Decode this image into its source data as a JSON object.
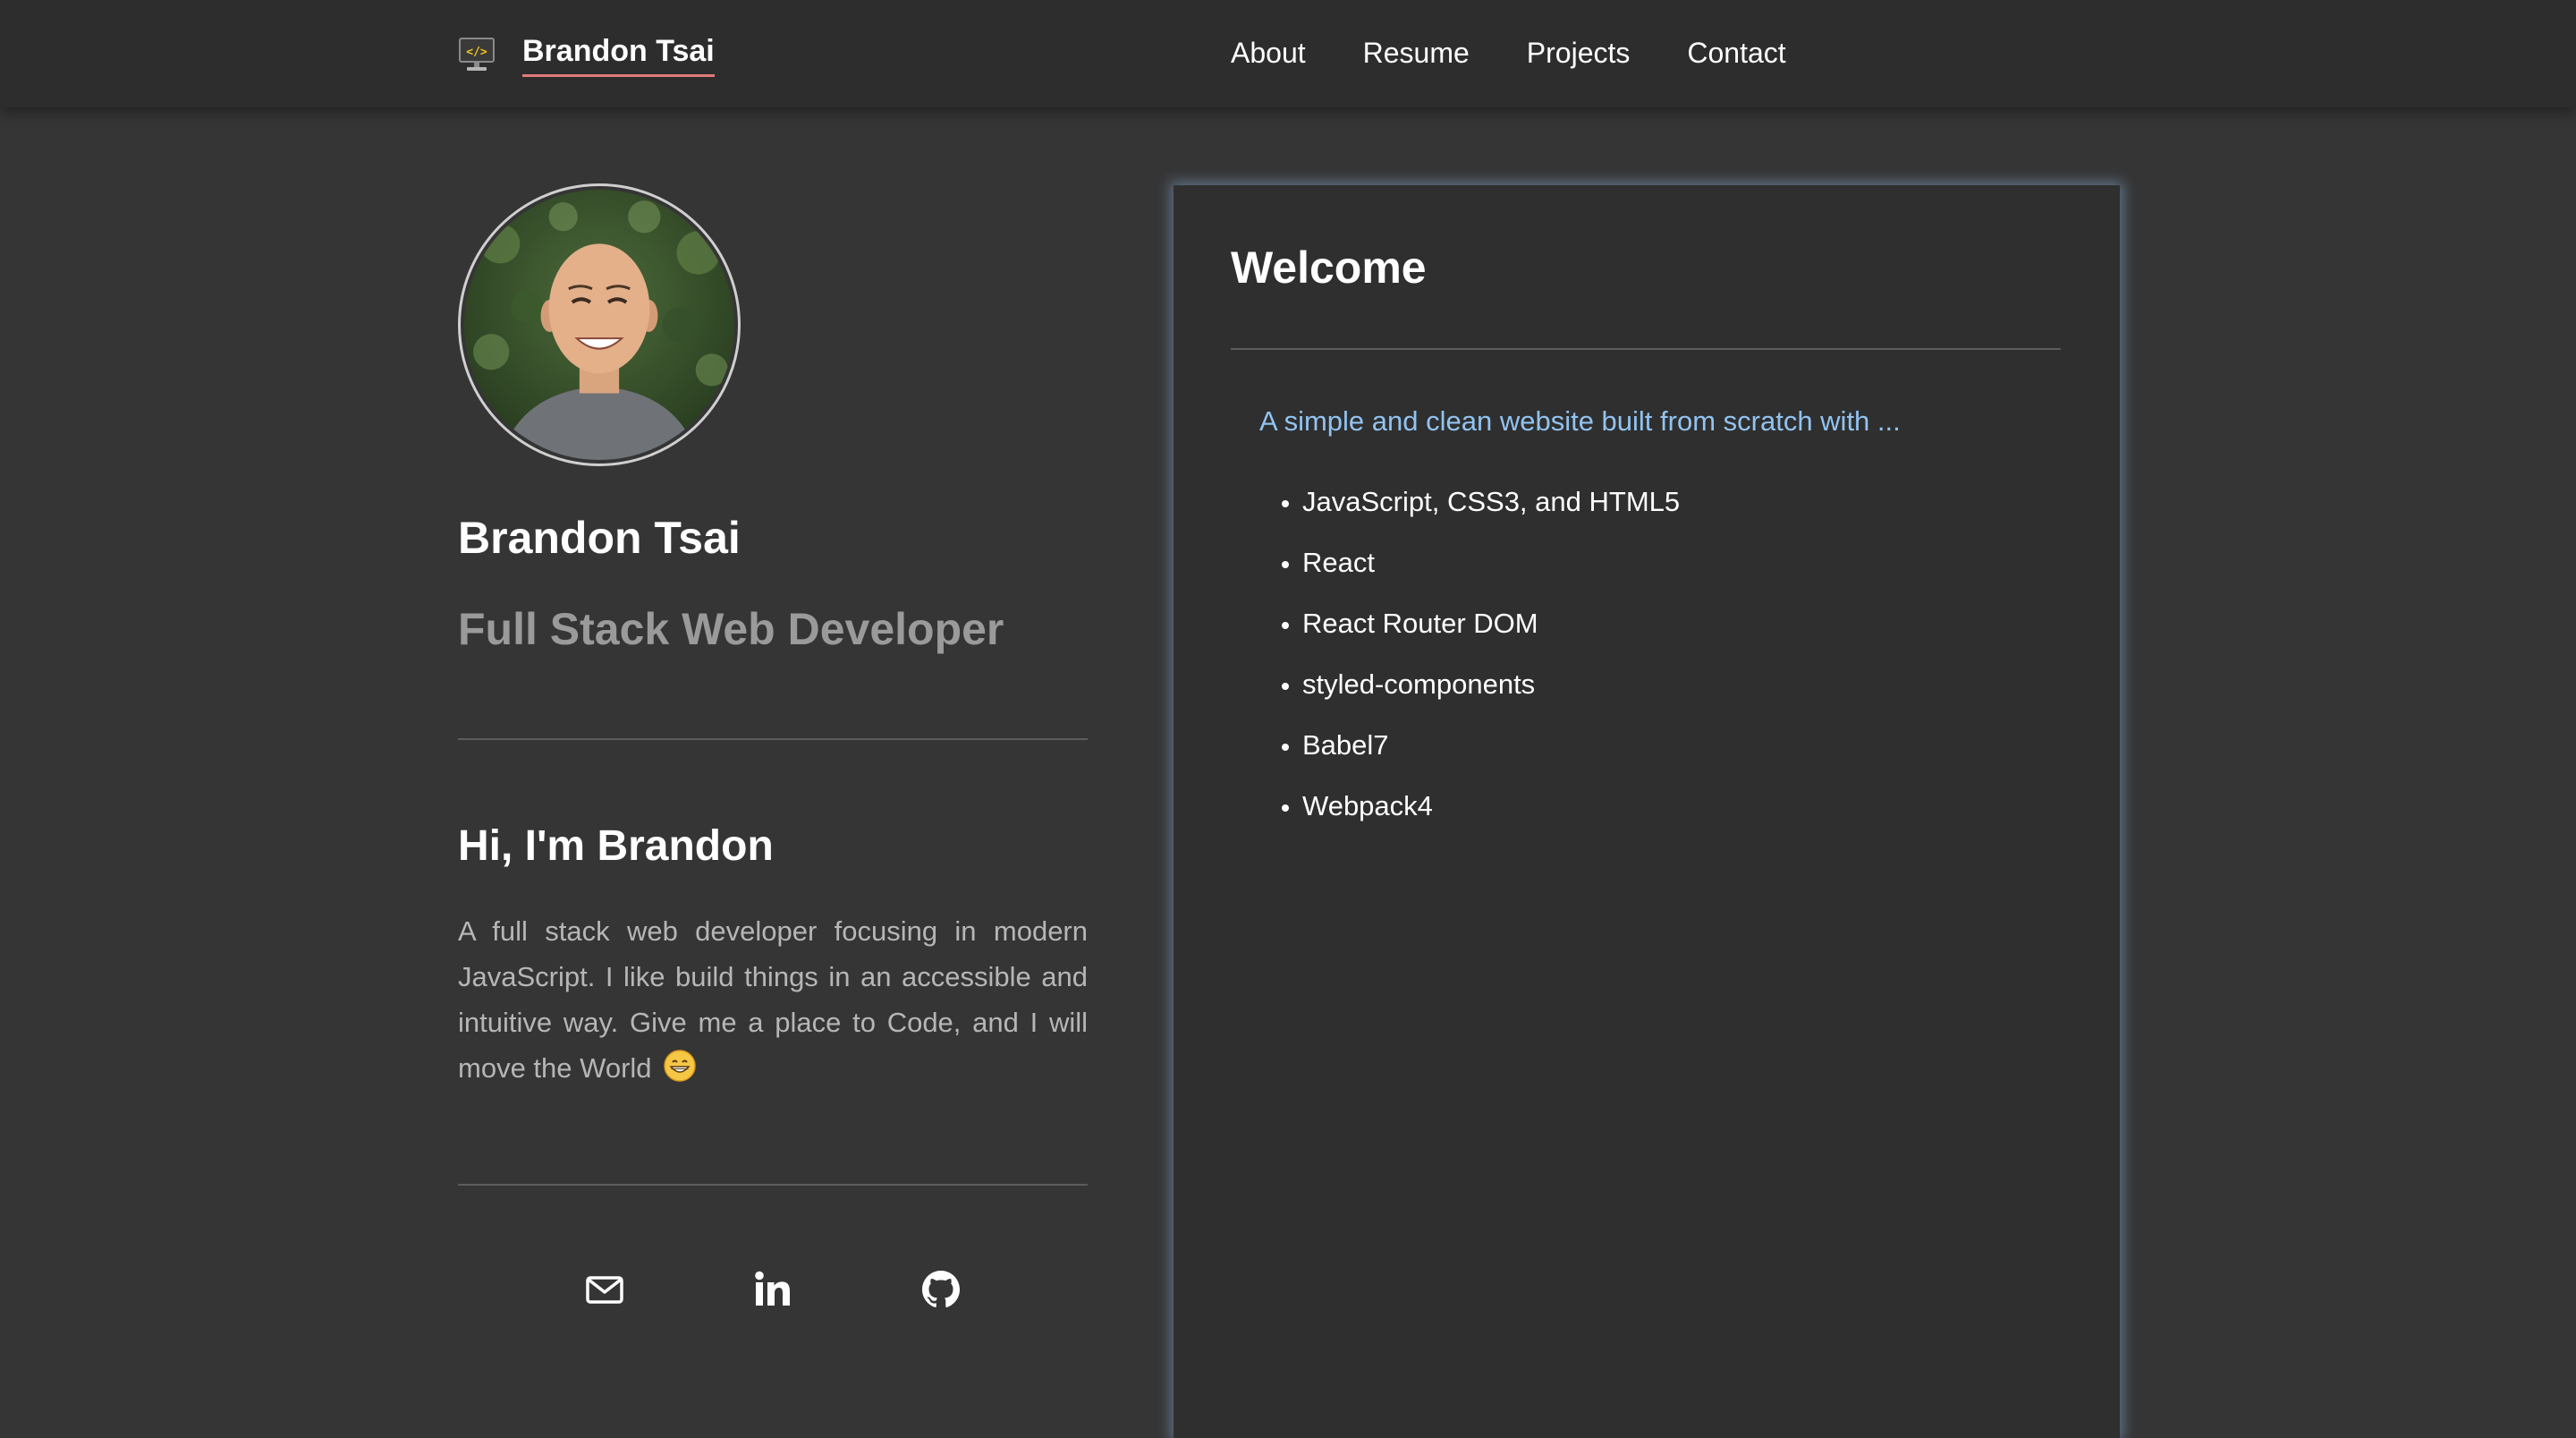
{
  "nav": {
    "brand_name": "Brandon Tsai",
    "brand_logo_icon": "code-monitor-icon",
    "links": [
      {
        "label": "About"
      },
      {
        "label": "Resume"
      },
      {
        "label": "Projects"
      },
      {
        "label": "Contact"
      }
    ],
    "brand_underline_color": "#e07a7a"
  },
  "profile": {
    "avatar_icon": "profile-photo",
    "name": "Brandon Tsai",
    "title": "Full Stack Web Developer",
    "greeting": "Hi, I'm Brandon",
    "bio": "A full stack web developer focusing in modern JavaScript. I like build things in an accessible and intuitive way. Give me a place to Code, and I will move the World",
    "bio_emoji_icon": "grinning-face-emoji",
    "socials": [
      {
        "icon": "email-icon"
      },
      {
        "icon": "linkedin-icon"
      },
      {
        "icon": "github-icon"
      }
    ]
  },
  "welcome": {
    "title": "Welcome",
    "intro": "A simple and clean website built from scratch with ...",
    "stack": [
      "JavaScript, CSS3, and HTML5",
      "React",
      "React Router DOM",
      "styled-components",
      "Babel7",
      "Webpack4"
    ],
    "intro_color": "#91c3f0",
    "card_glow_color": "#92bae6"
  },
  "colors": {
    "background": "#353535",
    "navbar": "#2d2d2d",
    "card": "#2f2f2f",
    "muted_text": "#9a9a9a"
  }
}
